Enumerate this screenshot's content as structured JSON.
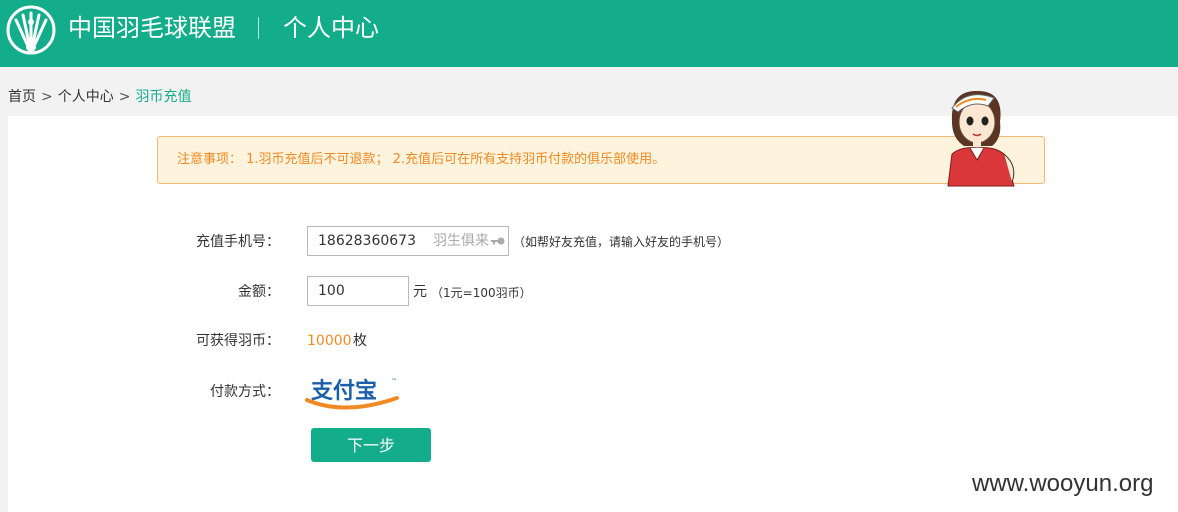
{
  "header": {
    "site_title": "中国羽毛球联盟",
    "section_title": "个人中心"
  },
  "breadcrumb": {
    "items": [
      "首页",
      "个人中心"
    ],
    "current": "羽币充值",
    "separator": ">"
  },
  "notice": {
    "text": "注意事项： 1.羽币充值后不可退款； 2.充值后可在所有支持羽币付款的俱乐部使用。"
  },
  "form": {
    "phone": {
      "label": "充值手机号：",
      "value": "18628360673",
      "placeholder": "羽生俱来",
      "hint": "（如帮好友充值，请输入好友的手机号）"
    },
    "amount": {
      "label": "金额：",
      "value": "100",
      "unit": "元",
      "hint": "（1元=100羽币）"
    },
    "coins": {
      "label": "可获得羽币：",
      "value": "10000",
      "unit": "枚"
    },
    "payment": {
      "label": "付款方式：",
      "method_logo": "支付宝"
    },
    "next_button": "下一步"
  },
  "watermark": "www.wooyun.org",
  "colors": {
    "brand": "#14ad8c",
    "accent": "#f08a24",
    "notice_bg": "#fef3dc"
  }
}
